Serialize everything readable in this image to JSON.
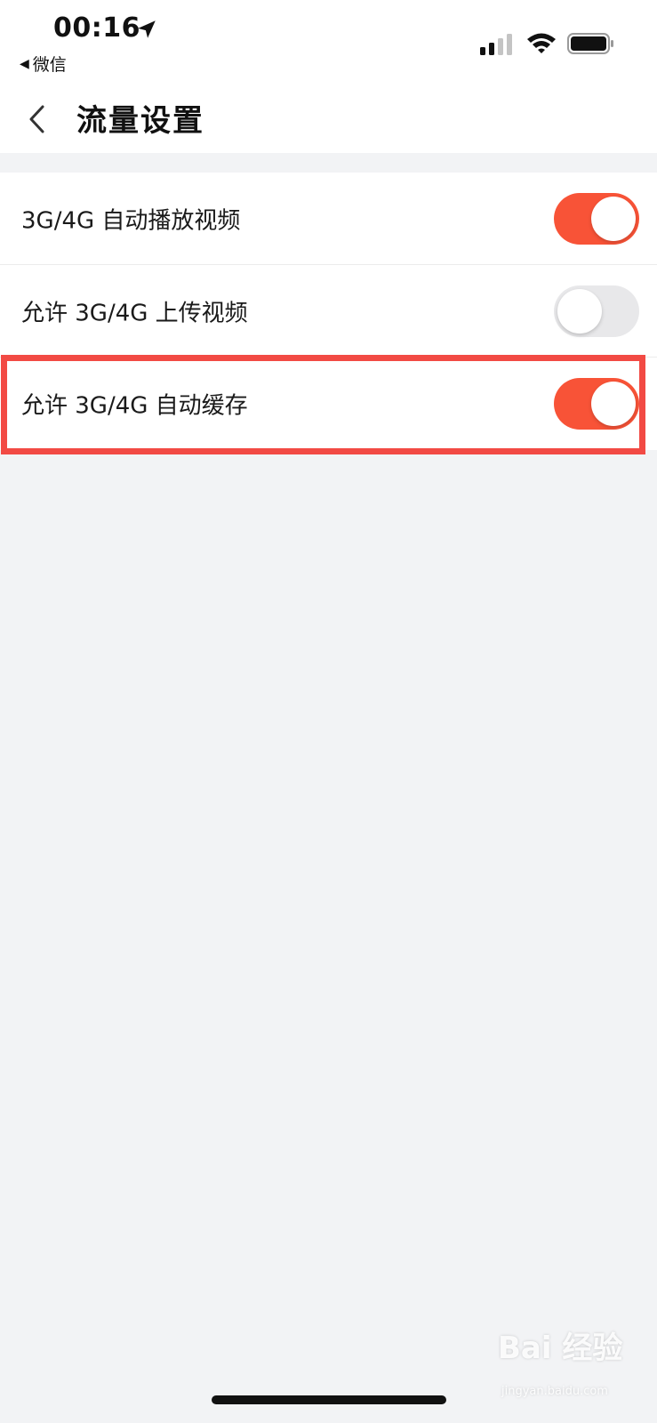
{
  "status_bar": {
    "time": "00:16",
    "back_app_label": "微信",
    "icons": [
      "location-arrow-icon",
      "signal-icon",
      "wifi-icon",
      "battery-icon"
    ]
  },
  "header": {
    "title": "流量设置",
    "back_icon": "chevron-left-icon"
  },
  "settings": [
    {
      "label": "3G/4G 自动播放视频",
      "enabled": true
    },
    {
      "label": "允许 3G/4G 上传视频",
      "enabled": false
    },
    {
      "label": "允许 3G/4G 自动缓存",
      "enabled": true
    }
  ],
  "watermark": {
    "text": "Bai 经验",
    "sub": "jingyan.baidu.com"
  },
  "colors": {
    "accent": "#f85337",
    "toggle_off": "#e8e8ea",
    "highlight": "#f24a44",
    "background": "#f2f3f5"
  }
}
